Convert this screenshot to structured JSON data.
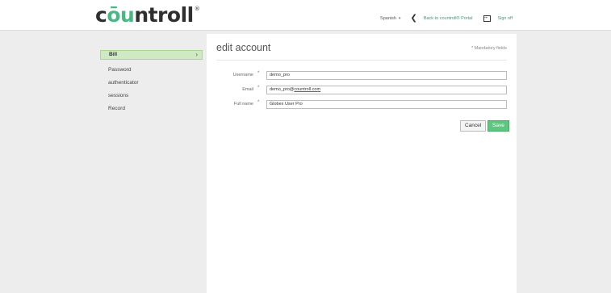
{
  "brand": {
    "logo_prefix": "c",
    "logo_accent": "ōu",
    "logo_suffix": "ntroll",
    "registered": "®",
    "accent_color": "#4ab784"
  },
  "header": {
    "language": "Spanish",
    "back_link": "Back to countroll® Portal",
    "sign_off": "Sign off"
  },
  "sidebar": {
    "items": [
      {
        "label": "Bill",
        "active": true
      },
      {
        "label": "Password"
      },
      {
        "label": "authenticator"
      },
      {
        "label": "sessions"
      },
      {
        "label": "Record"
      }
    ]
  },
  "form": {
    "title": "edit account",
    "mandatory_note": "* Mandatory fields",
    "fields": [
      {
        "label": "Username",
        "required": "*",
        "value": "demo_pro"
      },
      {
        "label": "Email",
        "required": "*",
        "value_prefix": "demo_pro@",
        "value_underlined": "countroll.com"
      },
      {
        "label": "Full name",
        "required": "*",
        "value": "Globex User Pro"
      }
    ],
    "cancel_label": "Cancel",
    "save_label": "Save",
    "save_color": "#5ec77f"
  }
}
